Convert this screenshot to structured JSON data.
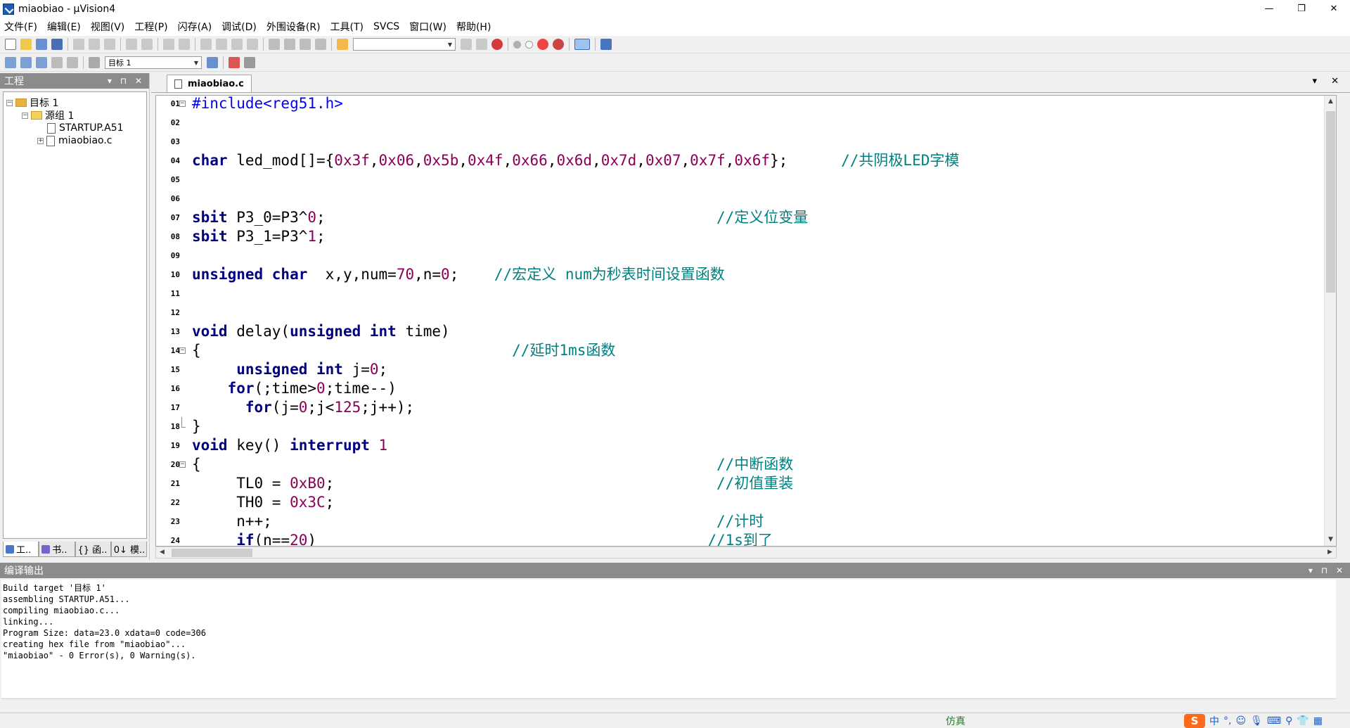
{
  "window": {
    "title": "miaobiao  - µVision4",
    "min": "—",
    "max": "❐",
    "close": "✕"
  },
  "menu": [
    "文件(F)",
    "编辑(E)",
    "视图(V)",
    "工程(P)",
    "闪存(A)",
    "调试(D)",
    "外围设备(R)",
    "工具(T)",
    "SVCS",
    "窗口(W)",
    "帮助(H)"
  ],
  "toolbar2": {
    "target": "目标 1"
  },
  "project": {
    "title": "工程",
    "root": "目标 1",
    "group": "源组 1",
    "files": [
      "STARTUP.A51",
      "miaobiao.c"
    ],
    "tabs": [
      "工..",
      "书..",
      "{} 函..",
      "0↓ 模.."
    ]
  },
  "editor": {
    "tab": "miaobiao.c",
    "lines": [
      {
        "n": "01",
        "code": "<span class=\"pp\">#include&lt;reg51.h&gt;</span>"
      },
      {
        "n": "02",
        "code": ""
      },
      {
        "n": "03",
        "code": ""
      },
      {
        "n": "04",
        "code": "<span class=\"kw\">char</span> led_mod[]={<span class=\"num\">0x3f</span>,<span class=\"num\">0x06</span>,<span class=\"num\">0x5b</span>,<span class=\"num\">0x4f</span>,<span class=\"num\">0x66</span>,<span class=\"num\">0x6d</span>,<span class=\"num\">0x7d</span>,<span class=\"num\">0x07</span>,<span class=\"num\">0x7f</span>,<span class=\"num\">0x6f</span>};      <span class=\"cm\">//共阴极LED字模</span>"
      },
      {
        "n": "05",
        "code": ""
      },
      {
        "n": "06",
        "code": ""
      },
      {
        "n": "07",
        "code": "<span class=\"kw\">sbit</span> P3_0=P3^<span class=\"num\">0</span>;                                            <span class=\"cm\">//定义位变量</span>"
      },
      {
        "n": "08",
        "code": "<span class=\"kw\">sbit</span> P3_1=P3^<span class=\"num\">1</span>;"
      },
      {
        "n": "09",
        "code": ""
      },
      {
        "n": "10",
        "code": "<span class=\"kw\">unsigned char</span>  x,y,num=<span class=\"num\">70</span>,n=<span class=\"num\">0</span>;    <span class=\"cm\">//宏定义 num为秒表时间设置函数</span>"
      },
      {
        "n": "11",
        "code": ""
      },
      {
        "n": "12",
        "code": ""
      },
      {
        "n": "13",
        "code": "<span class=\"kw\">void</span> delay(<span class=\"kw\">unsigned int</span> time)"
      },
      {
        "n": "14",
        "code": "{                                   <span class=\"cm\">//延时1ms函数</span>"
      },
      {
        "n": "15",
        "code": "     <span class=\"kw\">unsigned int</span> j=<span class=\"num\">0</span>;"
      },
      {
        "n": "16",
        "code": "    <span class=\"kw\">for</span>(;time&gt;<span class=\"num\">0</span>;time--)"
      },
      {
        "n": "17",
        "code": "      <span class=\"kw\">for</span>(j=<span class=\"num\">0</span>;j&lt;<span class=\"num\">125</span>;j++);"
      },
      {
        "n": "18",
        "code": "}"
      },
      {
        "n": "19",
        "code": "<span class=\"kw\">void</span> key() <span class=\"kw\">interrupt</span> <span class=\"num\">1</span>"
      },
      {
        "n": "20",
        "code": "{                                                          <span class=\"cm\">//中断函数</span>"
      },
      {
        "n": "21",
        "code": "     TL0 = <span class=\"num\">0xB0</span>;                                           <span class=\"cm\">//初值重装</span>"
      },
      {
        "n": "22",
        "code": "     TH0 = <span class=\"num\">0x3C</span>;"
      },
      {
        "n": "23",
        "code": "     n++;                                                  <span class=\"cm\">//计时</span>"
      },
      {
        "n": "24",
        "code": "     <span class=\"kw\">if</span>(n==<span class=\"num\">20</span>)                                            <span class=\"cm\">//1s到了</span>"
      }
    ]
  },
  "output": {
    "title": "编译输出",
    "lines": [
      "Build target '目标 1'",
      "assembling STARTUP.A51...",
      "compiling miaobiao.c...",
      "linking...",
      "Program Size: data=23.0 xdata=0 code=306",
      "creating hex file from \"miaobiao\"...",
      "\"miaobiao\" - 0 Error(s), 0 Warning(s)."
    ]
  },
  "status": {
    "mode": "仿真",
    "ime_s": "S",
    "ime_lang": "中",
    "ime_punct": "°,"
  },
  "colors": {
    "keyword": "#000080",
    "number": "#8b0057",
    "comment": "#008080",
    "preprocessor": "#0000ff",
    "panel_header": "#8b8b8b"
  }
}
